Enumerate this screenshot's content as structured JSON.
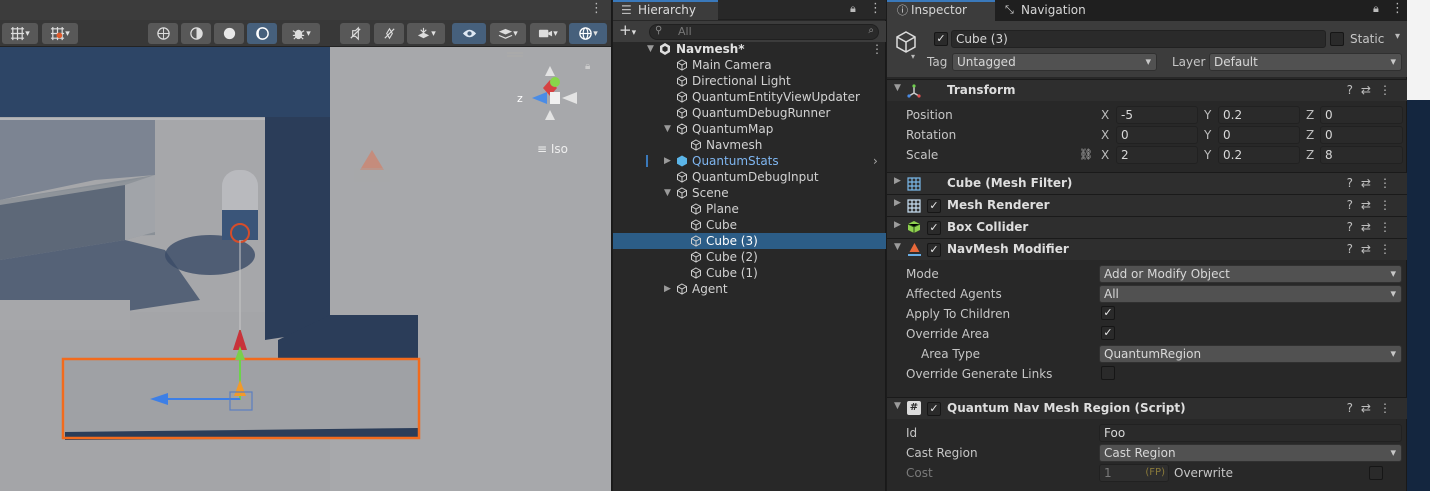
{
  "scene": {
    "view_mode": "Iso",
    "gizmo_axis_z": "z"
  },
  "hierarchy": {
    "tab_label": "Hierarchy",
    "search_placeholder": "All",
    "root": "Navmesh*",
    "rows": [
      {
        "label": "Main Camera",
        "indent": 1
      },
      {
        "label": "Directional Light",
        "indent": 1
      },
      {
        "label": "QuantumEntityViewUpdater",
        "indent": 1
      },
      {
        "label": "QuantumDebugRunner",
        "indent": 1
      },
      {
        "label": "QuantumMap",
        "indent": 1
      },
      {
        "label": "Navmesh",
        "indent": 2
      },
      {
        "label": "QuantumStats",
        "indent": 1
      },
      {
        "label": "QuantumDebugInput",
        "indent": 1
      },
      {
        "label": "Scene",
        "indent": 1
      },
      {
        "label": "Plane",
        "indent": 2
      },
      {
        "label": "Cube",
        "indent": 2
      },
      {
        "label": "Cube (3)",
        "indent": 2
      },
      {
        "label": "Cube (2)",
        "indent": 2
      },
      {
        "label": "Cube (1)",
        "indent": 2
      },
      {
        "label": "Agent",
        "indent": 1
      }
    ]
  },
  "inspector": {
    "tab_inspector": "Inspector",
    "tab_navigation": "Navigation",
    "object_name": "Cube (3)",
    "static_label": "Static",
    "tag_label": "Tag",
    "tag_value": "Untagged",
    "layer_label": "Layer",
    "layer_value": "Default",
    "transform": {
      "title": "Transform",
      "position_label": "Position",
      "rotation_label": "Rotation",
      "scale_label": "Scale",
      "position": {
        "x": "-5",
        "y": "0.2",
        "z": "0"
      },
      "rotation": {
        "x": "0",
        "y": "0",
        "z": "0"
      },
      "scale": {
        "x": "2",
        "y": "0.2",
        "z": "8"
      }
    },
    "mesh_filter_title": "Cube (Mesh Filter)",
    "mesh_renderer_title": "Mesh Renderer",
    "box_collider_title": "Box Collider",
    "navmesh_modifier": {
      "title": "NavMesh Modifier",
      "mode_label": "Mode",
      "mode_value": "Add or Modify Object",
      "affected_label": "Affected Agents",
      "affected_value": "All",
      "apply_children_label": "Apply To Children",
      "override_area_label": "Override Area",
      "area_type_label": "Area Type",
      "area_type_value": "QuantumRegion",
      "override_links_label": "Override Generate Links"
    },
    "region_script": {
      "title": "Quantum Nav Mesh Region (Script)",
      "id_label": "Id",
      "id_value": "Foo",
      "cast_label": "Cast Region",
      "cast_value": "Cast Region",
      "cost_label": "Cost",
      "cost_value": "1",
      "cost_unit": "(FP)",
      "overwrite_label": "Overwrite"
    },
    "axis_x": "X",
    "axis_y": "Y",
    "axis_z": "Z",
    "check_mark": "✓"
  },
  "colors": {
    "accent_blue": "#3a79bb",
    "selection": "#2c5d87",
    "scene_outline": "#f26b1d"
  }
}
